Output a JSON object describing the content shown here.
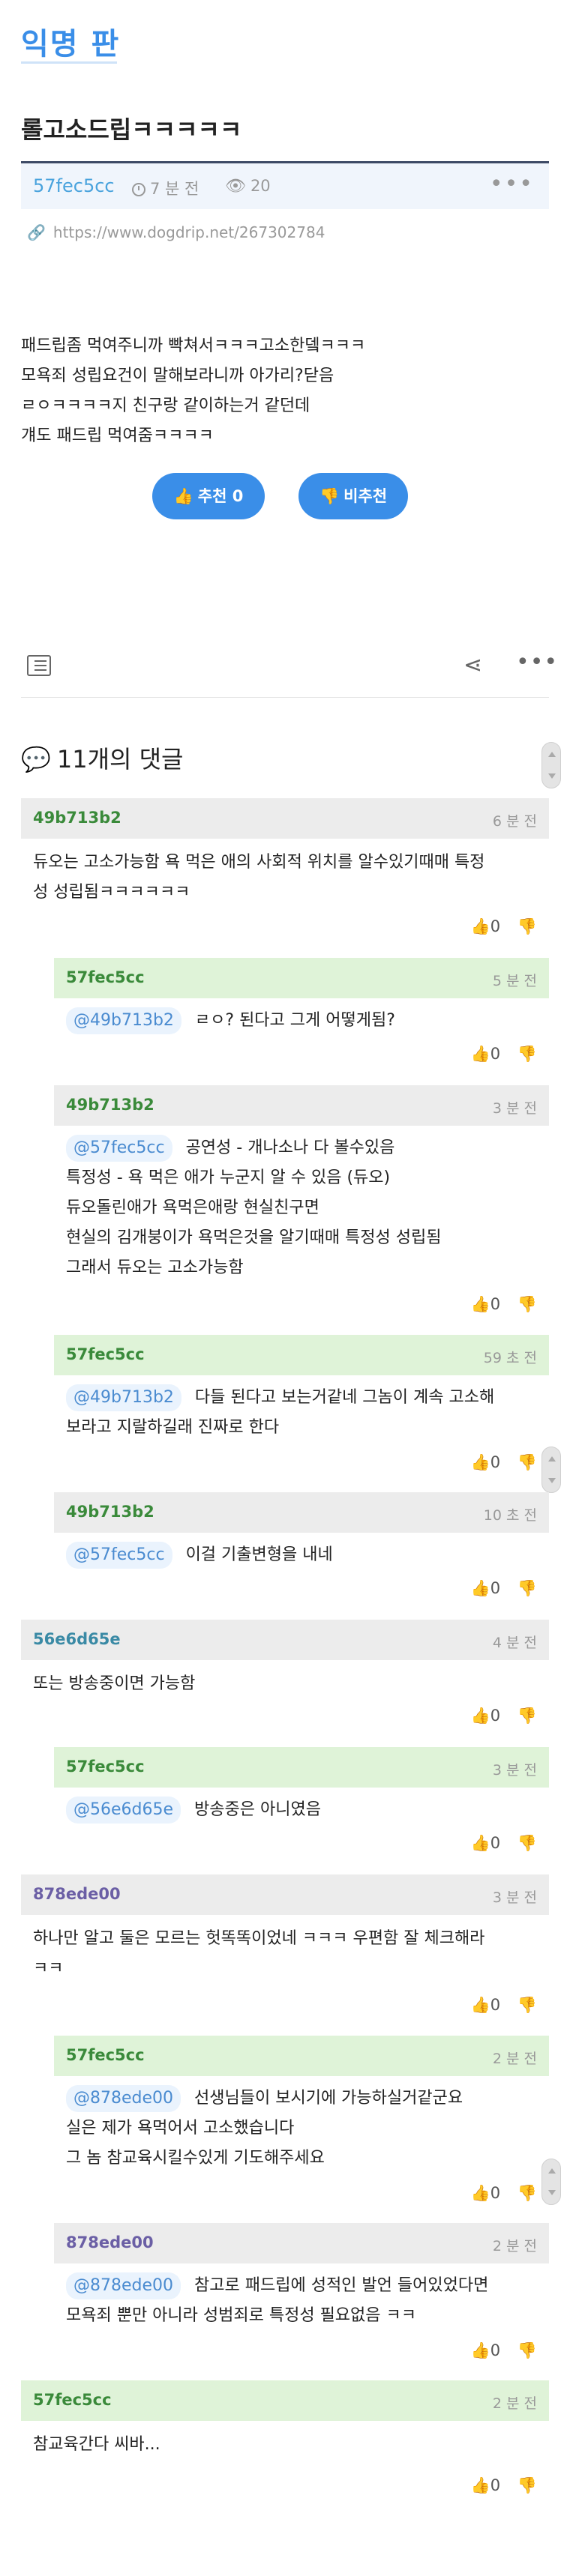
{
  "board": {
    "title": "익명 판"
  },
  "post": {
    "title": "롤고소드립ㅋㅋㅋㅋㅋ",
    "author": "57fec5cc",
    "time": "7 분 전",
    "views": "20",
    "url": "https://www.dogdrip.net/267302784",
    "body": [
      "패드립좀 먹여주니까 빡쳐서ㅋㅋㅋ고소한뎈ㅋㅋㅋ",
      "모욕죄 성립요건이 말해보라니까 아가리?닫음",
      "ㄹㅇㅋㅋㅋㅋ지 친구랑 같이하는거 같던데",
      "걔도 패드립 먹여줌ㅋㅋㅋㅋ"
    ],
    "upvote_label": "추천 0",
    "downvote_label": "비추천"
  },
  "comments_header": "11개의 댓글",
  "comments": [
    {
      "author": "49b713b2",
      "time": "6 분 전",
      "mention": "",
      "lines": [
        "듀오는 고소가능함 욕 먹은 애의 사회적 위치를 알수있기때매 특정",
        "성 성립됨ㅋㅋㅋㅋㅋㅋ"
      ],
      "likes": "0"
    },
    {
      "author": "57fec5cc",
      "time": "5 분 전",
      "mention": "@49b713b2",
      "lines": [
        "ㄹㅇ? 된다고 그게 어떻게됨?"
      ],
      "likes": "0"
    },
    {
      "author": "49b713b2",
      "time": "3 분 전",
      "mention": "@57fec5cc",
      "lines": [
        "공연성 - 개나소나 다 볼수있음",
        "특정성 - 욕 먹은 애가 누군지 알 수 있음 (듀오)",
        "듀오돌린애가 욕먹은애랑 현실친구면",
        "현실의 김개붕이가 욕먹은것을 알기때매 특정성 성립됨",
        "그래서 듀오는 고소가능함"
      ],
      "likes": "0"
    },
    {
      "author": "57fec5cc",
      "time": "59 초 전",
      "mention": "@49b713b2",
      "lines": [
        "다들 된다고 보는거같네 그놈이 계속 고소해",
        "보라고 지랄하길래 진짜로 한다"
      ],
      "likes": "0"
    },
    {
      "author": "49b713b2",
      "time": "10 초 전",
      "mention": "@57fec5cc",
      "lines": [
        "이걸 기출변형을 내네"
      ],
      "likes": "0"
    },
    {
      "author": "56e6d65e",
      "time": "4 분 전",
      "mention": "",
      "lines": [
        "또는 방송중이면 가능함"
      ],
      "likes": "0"
    },
    {
      "author": "57fec5cc",
      "time": "3 분 전",
      "mention": "@56e6d65e",
      "lines": [
        "방송중은 아니였음"
      ],
      "likes": "0"
    },
    {
      "author": "878ede00",
      "time": "3 분 전",
      "mention": "",
      "lines": [
        "하나만 알고 둘은 모르는 헛똑똑이었네 ㅋㅋㅋ 우편함 잘 체크해라",
        "ㅋㅋ"
      ],
      "likes": "0"
    },
    {
      "author": "57fec5cc",
      "time": "2 분 전",
      "mention": "@878ede00",
      "lines": [
        "선생님들이 보시기에 가능하실거같군요",
        "실은 제가 욕먹어서 고소했습니다",
        "그 놈 참교육시킬수있게 기도해주세요"
      ],
      "likes": "0"
    },
    {
      "author": "878ede00",
      "time": "2 분 전",
      "mention": "@878ede00",
      "lines": [
        "참고로 패드립에 성적인 발언 들어있었다면",
        "모욕죄 뿐만 아니라 성범죄로 특정성 필요없음 ㅋㅋ"
      ],
      "likes": "0"
    },
    {
      "author": "57fec5cc",
      "time": "2 분 전",
      "mention": "",
      "lines": [
        "참교육간다 씨바..."
      ],
      "likes": "0"
    }
  ]
}
